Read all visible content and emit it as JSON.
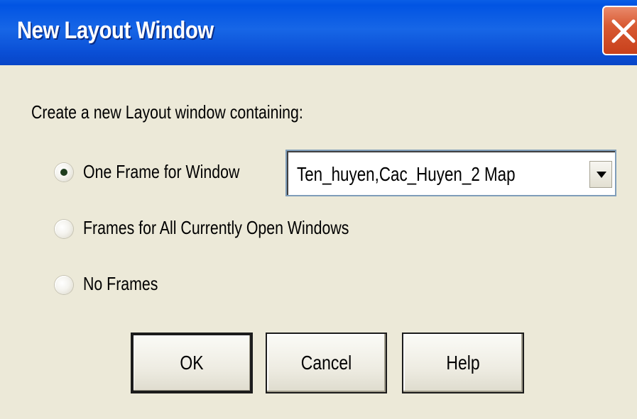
{
  "window": {
    "title": "New Layout Window",
    "close_icon": "close-icon"
  },
  "prompt": "Create a new Layout window containing:",
  "options": [
    {
      "label": "One Frame for Window",
      "selected": true
    },
    {
      "label": "Frames for All Currently Open Windows",
      "selected": false
    },
    {
      "label": "No Frames",
      "selected": false
    }
  ],
  "window_select": {
    "value": "Ten_huyen,Cac_Huyen_2 Map",
    "arrow_icon": "dropdown-arrow-icon"
  },
  "buttons": {
    "ok": "OK",
    "cancel": "Cancel",
    "help": "Help"
  },
  "colors": {
    "titlebar": "#0154e3",
    "dialog_background": "#ece9d8",
    "close_button": "#d85a33"
  }
}
